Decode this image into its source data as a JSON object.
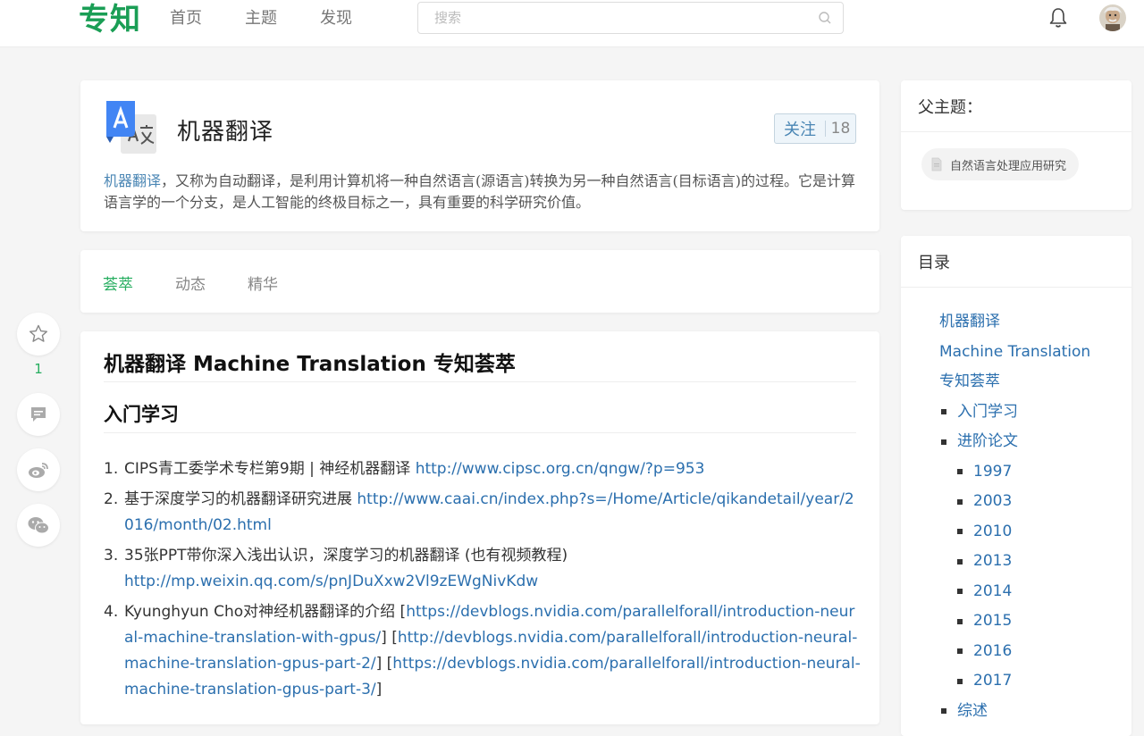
{
  "header": {
    "logo": "专知",
    "nav": [
      "首页",
      "主题",
      "发现"
    ],
    "search_placeholder": "搜索"
  },
  "topic": {
    "title": "机器翻译",
    "follow_label": "关注",
    "follow_count": "18",
    "desc_keyword": "机器翻译",
    "desc_rest": "，又称为自动翻译，是利用计算机将一种自然语言(源语言)转换为另一种自然语言(目标语言)的过程。它是计算语言学的一个分支，是人工智能的终极目标之一，具有重要的科学研究价值。"
  },
  "tabs": [
    "荟萃",
    "动态",
    "精华"
  ],
  "actions": {
    "star_count": "1"
  },
  "article": {
    "title": "机器翻译 Machine Translation 专知荟萃",
    "section_title": "入门学习",
    "items": [
      {
        "num": "1.",
        "text": "CIPS青工委学术专栏第9期 | 神经机器翻译 ",
        "link": "http://www.cipsc.org.cn/qngw/?p=953"
      },
      {
        "num": "2.",
        "text": "基于深度学习的机器翻译研究进展 ",
        "link": "http://www.caai.cn/index.php?s=/Home/Article/qikandetail/year/2016/month/02.html"
      },
      {
        "num": "3.",
        "text": "35张PPT带你深入浅出认识，深度学习的机器翻译 (也有视频教程)",
        "link": "http://mp.weixin.qq.com/s/pnJDuXxw2Vl9zEWgNivKdw"
      },
      {
        "num": "4.",
        "text": "Kyunghyun Cho对神经机器翻译的介绍 [",
        "link1": "https://devblogs.nvidia.com/parallelforall/introduction-neural-machine-translation-with-gpus/",
        "sep1": "] [",
        "link2": "http://devblogs.nvidia.com/parallelforall/introduction-neural-machine-translation-gpus-part-2/",
        "sep2": "] [",
        "link3": "https://devblogs.nvidia.com/parallelforall/introduction-neural-machine-translation-gpus-part-3/",
        "sep3": "]"
      }
    ]
  },
  "sidebar": {
    "parent_heading": "父主题：",
    "parent_topic": "自然语言处理应用研究",
    "toc_heading": "目录",
    "toc_top": [
      "机器翻译",
      "Machine Translation",
      "专知荟萃"
    ],
    "toc_l1_a": "入门学习",
    "toc_l1_b": "进阶论文",
    "toc_years": [
      "1997",
      "2003",
      "2010",
      "2013",
      "2014",
      "2015",
      "2016",
      "2017"
    ],
    "toc_l1_c": "综述"
  },
  "colors": {
    "brand_green": "#1a9e55",
    "link_blue": "#2b6fae",
    "active_tab": "#27ae60"
  }
}
